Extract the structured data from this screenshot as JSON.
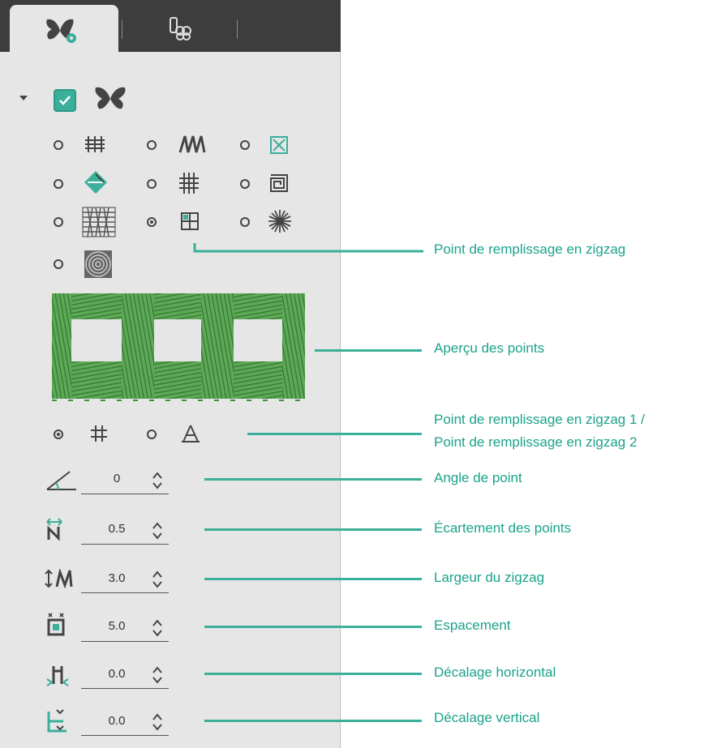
{
  "tabs": [
    {
      "icon": "butterfly-gear-icon",
      "active": true
    },
    {
      "icon": "thread-spools-icon",
      "active": false
    }
  ],
  "section": {
    "expanded": true,
    "checked": true,
    "icon": "butterfly-icon"
  },
  "stitch_types": [
    {
      "icon": "triple-stitch-icon",
      "selected": false
    },
    {
      "icon": "zigzag-satin-icon",
      "selected": false
    },
    {
      "icon": "cross-box-icon",
      "selected": false
    },
    {
      "icon": "diamond-fill-icon",
      "selected": false
    },
    {
      "icon": "grid-hash-icon",
      "selected": false
    },
    {
      "icon": "spiral-square-icon",
      "selected": false
    },
    {
      "icon": "honeycomb-fill-icon",
      "selected": false
    },
    {
      "icon": "zigzag-fill-grid-icon",
      "selected": true
    },
    {
      "icon": "radial-burst-icon",
      "selected": false
    },
    {
      "icon": "concentric-circles-icon",
      "selected": false
    }
  ],
  "zigzag_variants": [
    {
      "icon": "hash-icon",
      "selected": true
    },
    {
      "icon": "tripod-icon",
      "selected": false
    }
  ],
  "fields": [
    {
      "icon": "angle-icon",
      "value": "0"
    },
    {
      "icon": "stitch-spacing-icon",
      "value": "0.5"
    },
    {
      "icon": "zigzag-width-icon",
      "value": "3.0"
    },
    {
      "icon": "spacing-icon",
      "value": "5.0"
    },
    {
      "icon": "horizontal-offset-icon",
      "value": "0.0"
    },
    {
      "icon": "vertical-offset-icon",
      "value": "0.0"
    }
  ],
  "callouts": {
    "stitch_type": "Point de remplissage en zigzag",
    "preview": "Aperçu des points",
    "variant_1": "Point de remplissage en zigzag 1 /",
    "variant_2": "Point de remplissage en zigzag 2",
    "angle": "Angle de point",
    "spacing": "Écartement des points",
    "width": "Largeur du zigzag",
    "gap": "Espacement",
    "h_offset": "Décalage horizontal",
    "v_offset": "Décalage vertical"
  },
  "colors": {
    "accent": "#3aaf9a",
    "stitch_green": "#3f8f3a",
    "callout_text": "#1aa38a",
    "dark_tabbar": "#3d3d3d"
  }
}
